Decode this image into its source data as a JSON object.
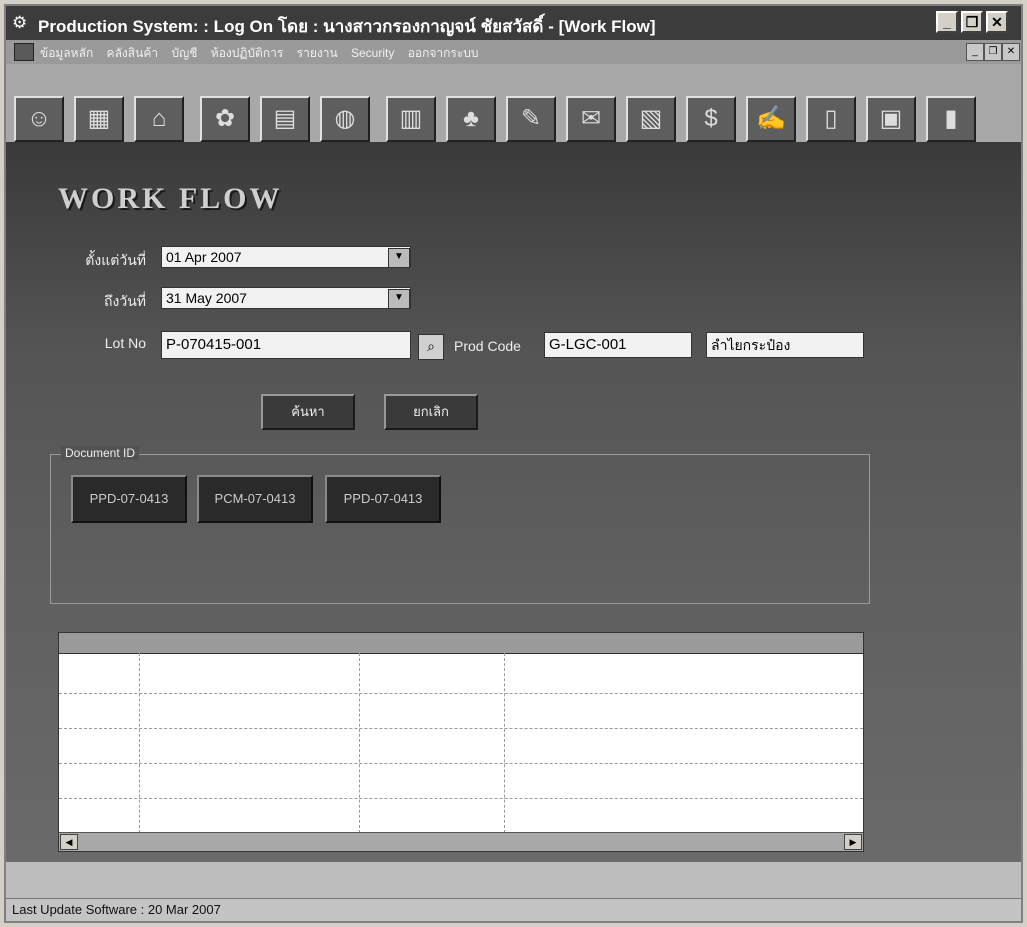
{
  "window": {
    "title": "Production System: : Log On โดย :  นางสาวกรองกาญจน์ ชัยสวัสดิ์ - [Work Flow]",
    "app_icon": "app-icon",
    "minimize": "_",
    "restore": "❐",
    "close": "✕"
  },
  "menu": {
    "items": [
      "ข้อมูลหลัก",
      "คลังสินค้า",
      "บัญชี",
      "ห้องปฏิบัติการ",
      "รายงาน",
      "Security",
      "ออกจากระบบ"
    ],
    "mdi_minimize": "_",
    "mdi_restore": "❐",
    "mdi_close": "✕"
  },
  "toolbar": {
    "icons": [
      "user-icon",
      "map-icon",
      "house-icon",
      "flower-icon",
      "grid-icon",
      "globe-icon",
      "chart-icon",
      "tree-icon",
      "tool-icon",
      "mail-icon",
      "calendar-icon",
      "money-icon",
      "notes-icon",
      "document-icon",
      "book-icon",
      "exit-door-icon"
    ]
  },
  "form": {
    "title": "WORK FLOW",
    "from_label": "ตั้งแต่วันที่",
    "from_date": "01 Apr 2007",
    "to_label": "ถึงวันที่",
    "to_date": "31 May 2007",
    "lot_label": "Lot No",
    "lot_value": "P-070415-001",
    "prod_code_label": "Prod Code",
    "prod_code_value": "G-LGC-001",
    "prod_name_value": "ลำไยกระป๋อง",
    "button_1": "ค้นหา",
    "button_2": "ยกเลิก",
    "document_group_label": "Document ID",
    "documents": [
      "PPD-07-0413",
      "PCM-07-0413",
      "PPD-07-0413"
    ]
  },
  "status": {
    "text": "Last Update Software : 20 Mar 2007"
  }
}
